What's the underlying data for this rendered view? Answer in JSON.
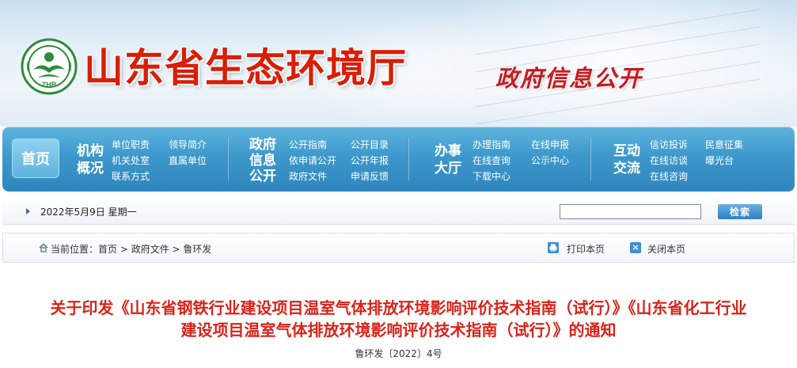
{
  "header": {
    "site_title": "山东省生态环境厅",
    "subtitle": "政府信息公开",
    "logo_text": "ZHB"
  },
  "nav": {
    "home": "首页",
    "groups": [
      {
        "heading": [
          "机构",
          "概况"
        ],
        "links": [
          "单位职责",
          "领导简介",
          "机关处室",
          "直属单位",
          "联系方式"
        ]
      },
      {
        "heading": [
          "政府",
          "信息",
          "公开"
        ],
        "links": [
          "公开指南",
          "公开目录",
          "依申请公开",
          "公开年报",
          "政府文件",
          "申请反馈"
        ]
      },
      {
        "heading": [
          "办事",
          "大厅"
        ],
        "links": [
          "办理指南",
          "在线申报",
          "在线查询",
          "公示中心",
          "下载中心"
        ]
      },
      {
        "heading": [
          "互动",
          "交流"
        ],
        "links": [
          "信访投诉",
          "民意征集",
          "在线访谈",
          "曝光台",
          "在线咨询"
        ]
      }
    ]
  },
  "date_bar": {
    "date": "2022年5月9日 星期一",
    "search_placeholder": "",
    "search_button": "检索"
  },
  "breadcrumb": {
    "prefix": "当前位置：",
    "items": [
      "首页",
      "政府文件",
      "鲁环发"
    ],
    "separator": " > ",
    "print": "打印本页",
    "close": "关闭本页"
  },
  "article": {
    "title_line1": "关于印发《山东省钢铁行业建设项目温室气体排放环境影响评价技术指南（试行）》《山东省化工行业",
    "title_line2": "建设项目温室气体排放环境影响评价技术指南（试行）》的通知",
    "doc_number": "鲁环发〔2022〕4号"
  },
  "colors": {
    "title_red": "#d81e06",
    "nav_blue": "#3d98cc",
    "article_red": "#d9231a",
    "logo_green": "#2e8b3a"
  }
}
